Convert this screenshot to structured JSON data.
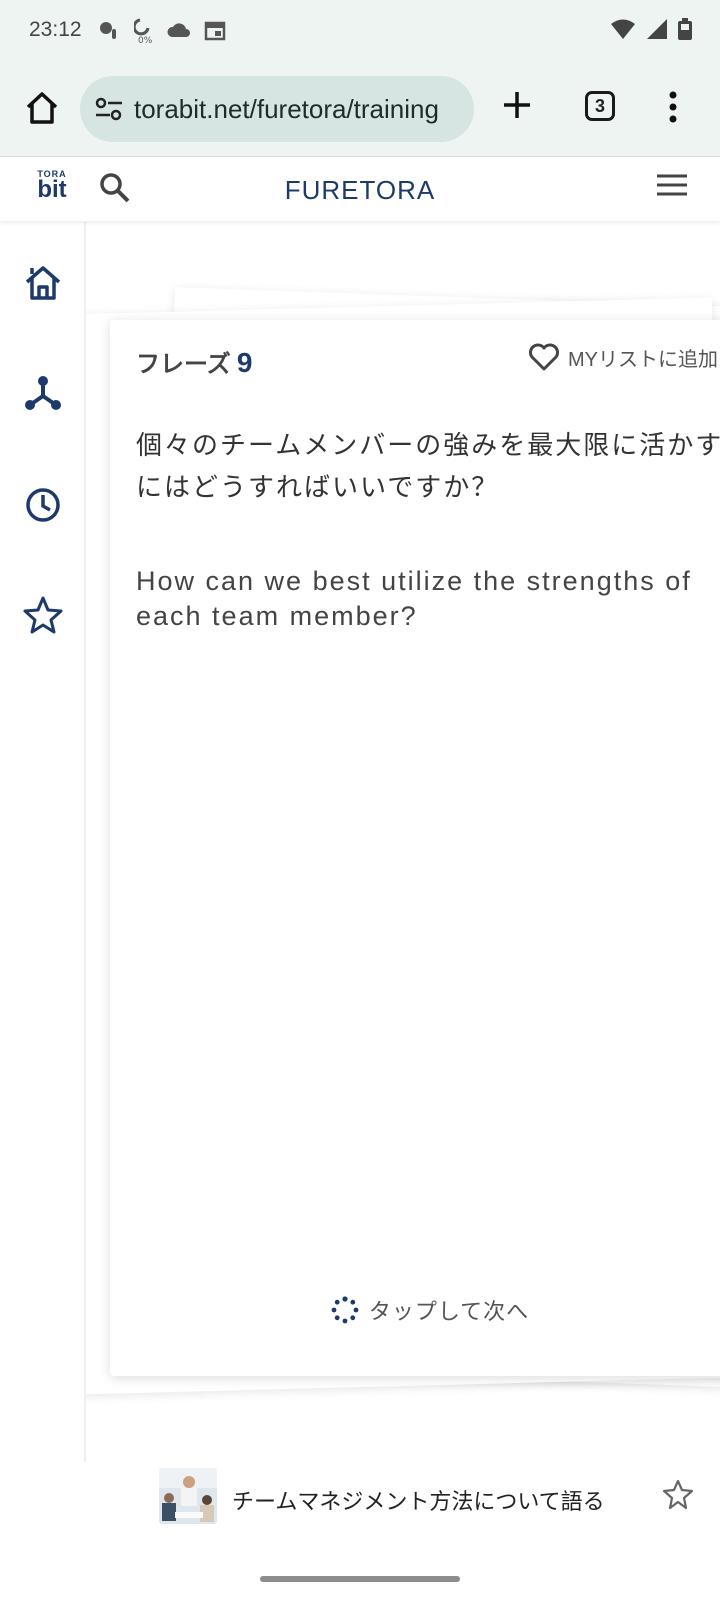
{
  "status_bar": {
    "time": "23:12",
    "left_icons": [
      "motorcycle-alert-icon",
      "battery-saver-icon",
      "cloud-icon",
      "calendar-icon"
    ],
    "right_icons": [
      "wifi-icon",
      "signal-icon",
      "battery-icon"
    ]
  },
  "browser": {
    "url": "torabit.net/furetora/training",
    "tab_count": "3"
  },
  "site_header": {
    "logo_top": "TORA",
    "logo_bottom": "bit",
    "title": "FURETORA"
  },
  "sidenav": {
    "items": [
      "home-icon",
      "network-icon",
      "history-icon",
      "favorites-icon"
    ]
  },
  "card": {
    "phrase_label": "フレーズ",
    "phrase_number": "9",
    "mylist_label": "MYリストに追加",
    "japanese_line1": "個々のチームメンバーの強みを最大限に活かす",
    "japanese_line2": "にはどうすればいいですか？",
    "english": "How can we best utilize the strengths of each team member?",
    "next_label": "タップして次へ"
  },
  "bottom_item": {
    "title": "チームマネジメント方法について語る"
  },
  "colors": {
    "accent_navy": "#1d3a6b",
    "chrome_bg": "#eef4f2",
    "url_bg": "#d6e5e1"
  }
}
